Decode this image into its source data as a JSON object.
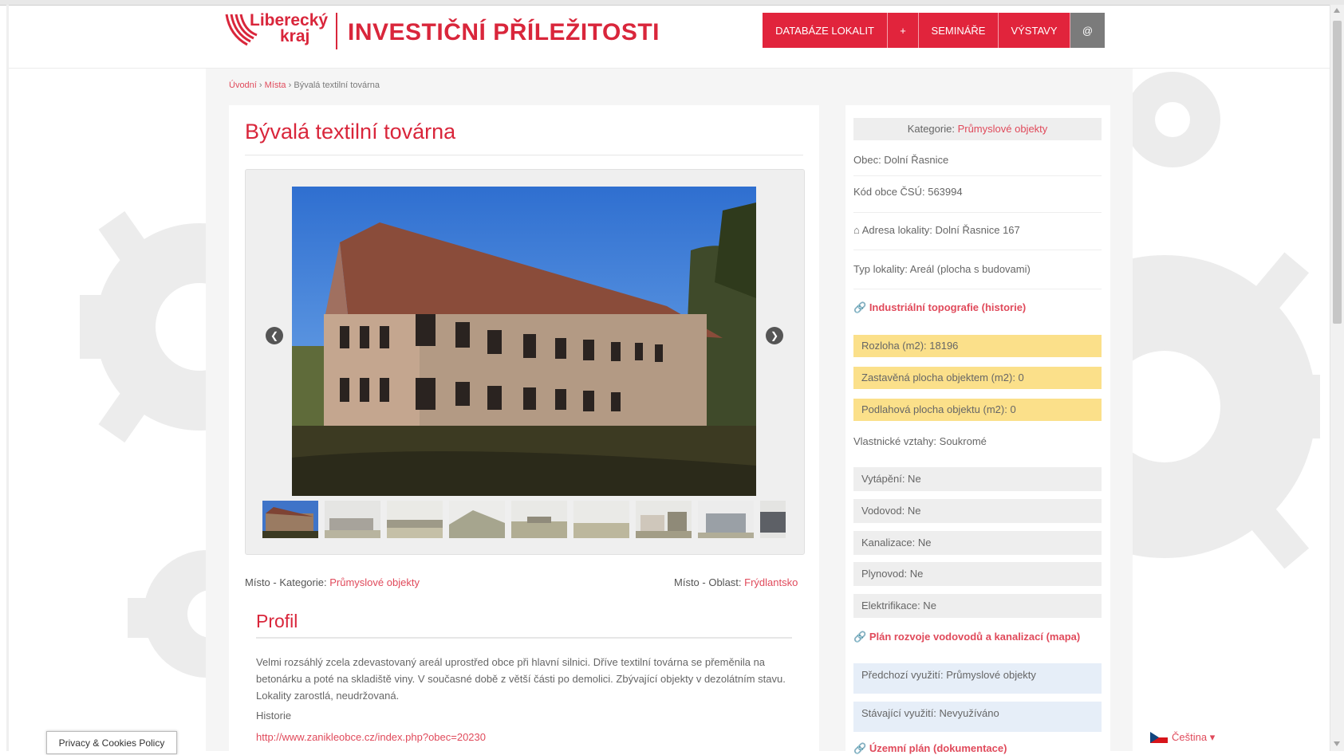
{
  "header": {
    "logo_text_line1": "Liberecký",
    "logo_text_line2": "kraj",
    "site_title": "INVESTIČNÍ PŘÍLEŽITOSTI",
    "nav": [
      {
        "label": "DATABÁZE LOKALIT"
      },
      {
        "label": "+"
      },
      {
        "label": "SEMINÁŘE"
      },
      {
        "label": "VÝSTAVY"
      },
      {
        "label": "@"
      }
    ]
  },
  "breadcrumb": {
    "home": "Úvodní",
    "sep": "›",
    "places": "Místa",
    "current": "Bývalá textilní továrna"
  },
  "page": {
    "title": "Bývalá textilní továrna",
    "meta_category_label": "Místo - Kategorie:",
    "meta_category_value": "Průmyslové objekty",
    "meta_area_label": "Místo - Oblast:",
    "meta_area_value": "Frýdlantsko",
    "profile_heading": "Profil",
    "profile_text": "Velmi rozsáhlý zcela zdevastovaný areál uprostřed obce při hlavní silnici. Dříve textilní továrna se přeměnila na betonárku a poté na skladiště viny. V současné době z větší části po demolici. Zbývající objekty v dezolátním stavu. Lokality zarostlá, neudržovaná.",
    "history_label": "Historie",
    "history_link": "http://www.zanikleobce.cz/index.php?obec=20230"
  },
  "gallery": {
    "thumb_count": 9
  },
  "sidebar": {
    "category_label": "Kategorie:",
    "category_value": "Průmyslové objekty",
    "municipality": "Obec: Dolní Řasnice",
    "csu_code": "Kód obce ČSÚ: 563994",
    "address": "Adresa lokality: Dolní Řasnice 167",
    "type": "Typ lokality: Areál (plocha s budovami)",
    "industrial_link": "Industriální topografie (historie)",
    "area": "Rozloha (m2): 18196",
    "built_area": "Zastavěná plocha objektem (m2): 0",
    "floor_area": "Podlahová plocha objektu (m2): 0",
    "ownership": "Vlastnické vztahy: Soukromé",
    "heating": "Vytápění: Ne",
    "water": "Vodovod: Ne",
    "sewer": "Kanalizace: Ne",
    "gas": "Plynovod: Ne",
    "electricity": "Elektrifikace: Ne",
    "water_plan_link": "Plán rozvoje vodovodů a kanalizací (mapa)",
    "previous_use": "Předchozí využití: Průmyslové objekty",
    "current_use": "Stávající využití: Nevyužíváno",
    "bottom_link": "Územní plán (dokumentace)"
  },
  "footer": {
    "privacy": "Privacy & Cookies Policy",
    "language": "Čeština ▾"
  },
  "colors": {
    "brand_red": "#e1243c",
    "highlight_yellow": "#fbe08a",
    "info_blue": "#e6eef8"
  }
}
